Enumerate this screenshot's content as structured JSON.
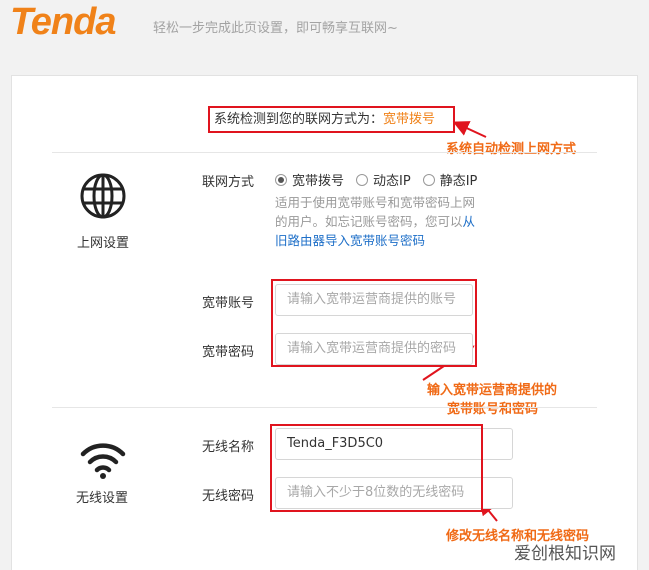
{
  "header": {
    "logo": "Tenda",
    "tagline": "轻松一步完成此页设置，即可畅享互联网~"
  },
  "detect": {
    "prefix": "系统检测到您的联网方式为：",
    "value": "宽带拨号"
  },
  "annotations": {
    "auto_detect": "系统自动检测上网方式",
    "account_line1": "输入宽带运营商提供的",
    "account_line2": "宽带账号和密码",
    "wireless": "修改无线名称和无线密码"
  },
  "internet": {
    "section_label": "上网设置",
    "icon": "globe-icon",
    "mode_label": "联网方式",
    "modes": [
      {
        "label": "宽带拨号",
        "selected": true
      },
      {
        "label": "动态IP",
        "selected": false
      },
      {
        "label": "静态IP",
        "selected": false
      }
    ],
    "desc_text": "适用于使用宽带账号和宽带密码上网的用户。如忘记账号密码，您可以",
    "desc_link": "从旧路由器导入宽带账号密码",
    "account_label": "宽带账号",
    "account_placeholder": "请输入宽带运营商提供的账号",
    "password_label": "宽带密码",
    "password_placeholder": "请输入宽带运营商提供的密码"
  },
  "wireless": {
    "section_label": "无线设置",
    "icon": "wifi-icon",
    "ssid_label": "无线名称",
    "ssid_value": "Tenda_F3D5C0",
    "password_label": "无线密码",
    "password_placeholder": "请输入不少于8位数的无线密码"
  },
  "watermark": "爱创根知识网",
  "colors": {
    "brand": "#f08219",
    "annotation": "#e0141e",
    "link": "#1e6fc8"
  }
}
